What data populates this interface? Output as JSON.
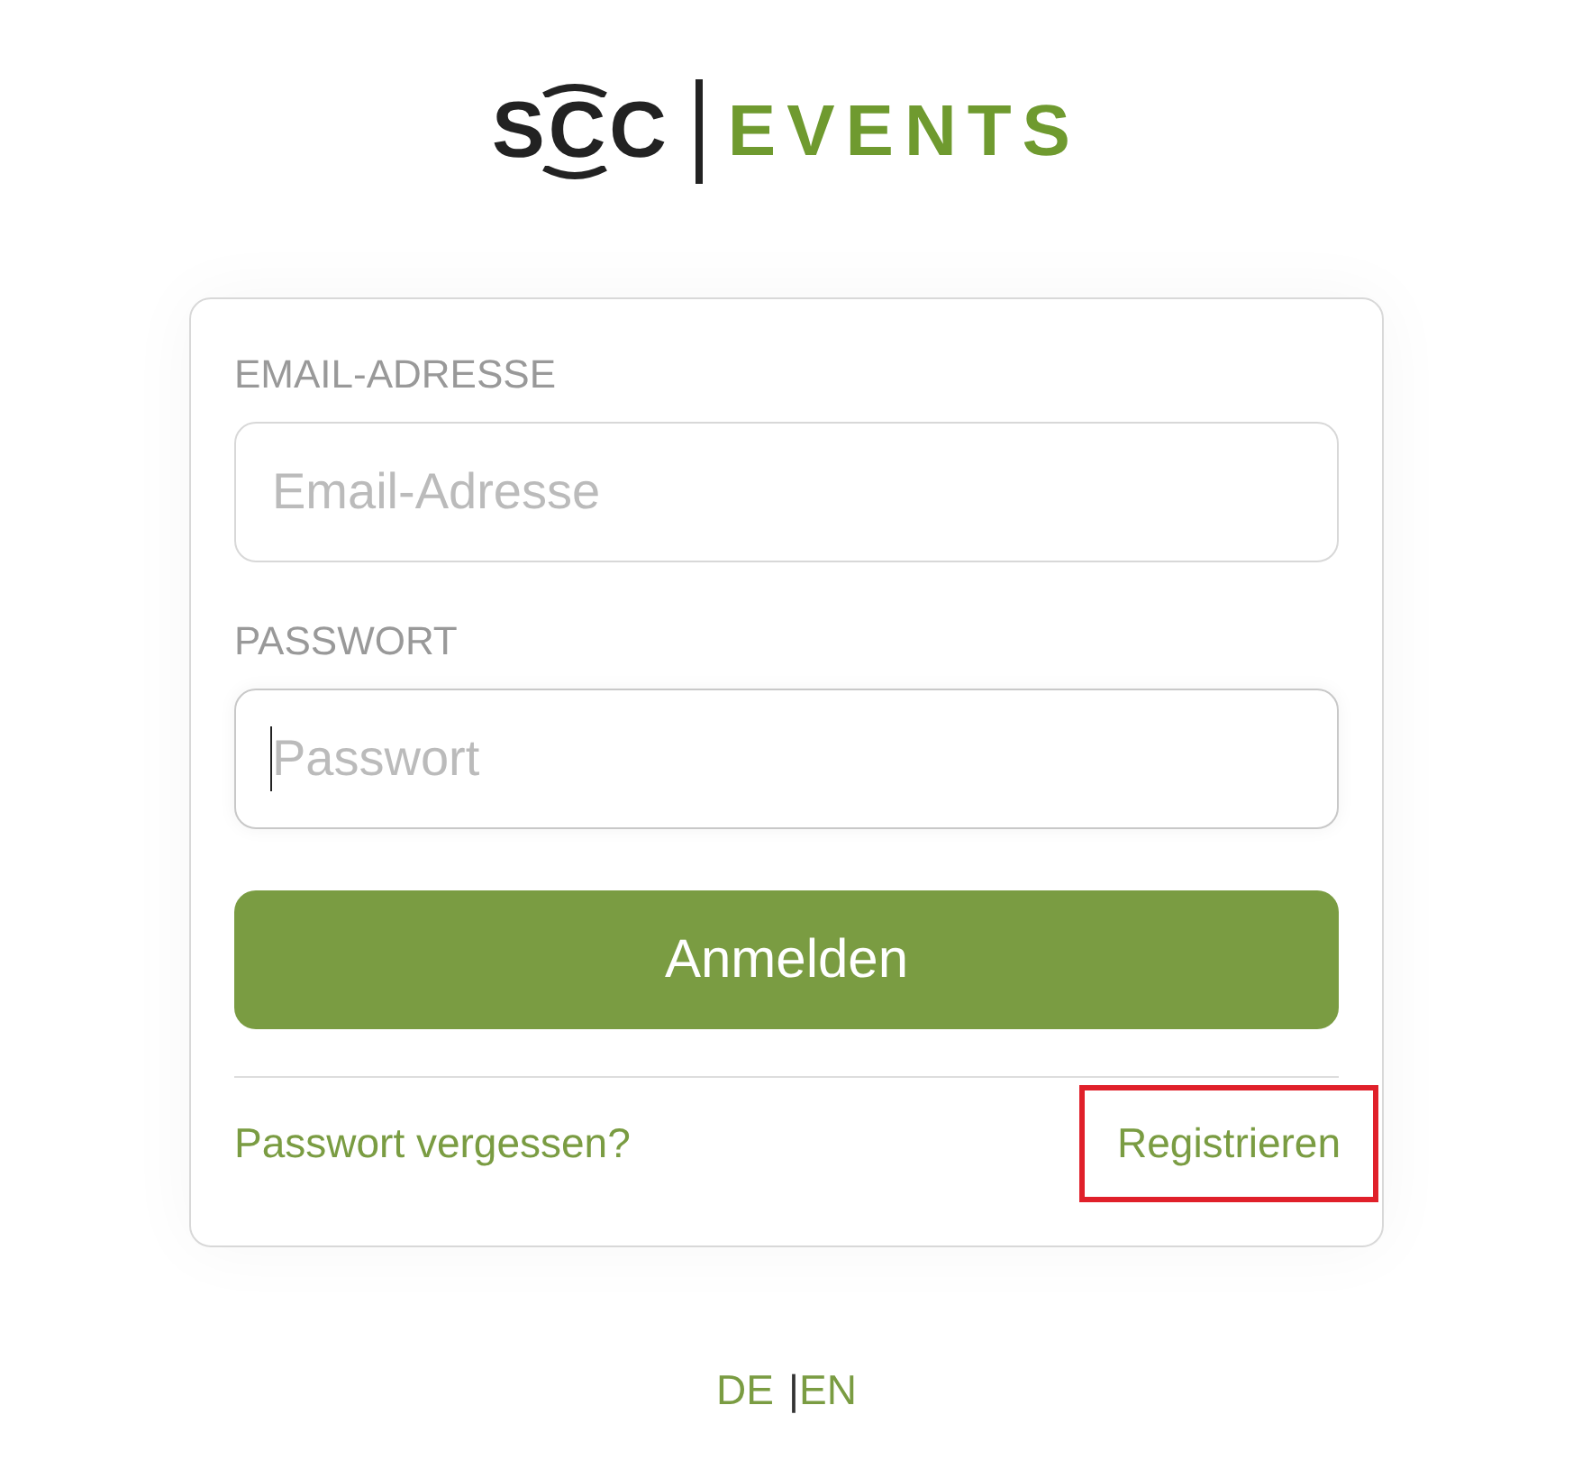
{
  "logo": {
    "brand": "SCC",
    "product": "EVENTS"
  },
  "form": {
    "fields": [
      {
        "label": "EMAIL-ADRESSE",
        "placeholder": "Email-Adresse",
        "focused": false
      },
      {
        "label": "PASSWORT",
        "placeholder": "Passwort",
        "focused": true
      }
    ],
    "submit": "Anmelden",
    "links": [
      {
        "label": "Passwort vergessen?",
        "highlighted": false
      },
      {
        "label": "Registrieren",
        "highlighted": true
      }
    ]
  },
  "languages": {
    "items": [
      "DE",
      "EN"
    ],
    "separator": "|"
  }
}
